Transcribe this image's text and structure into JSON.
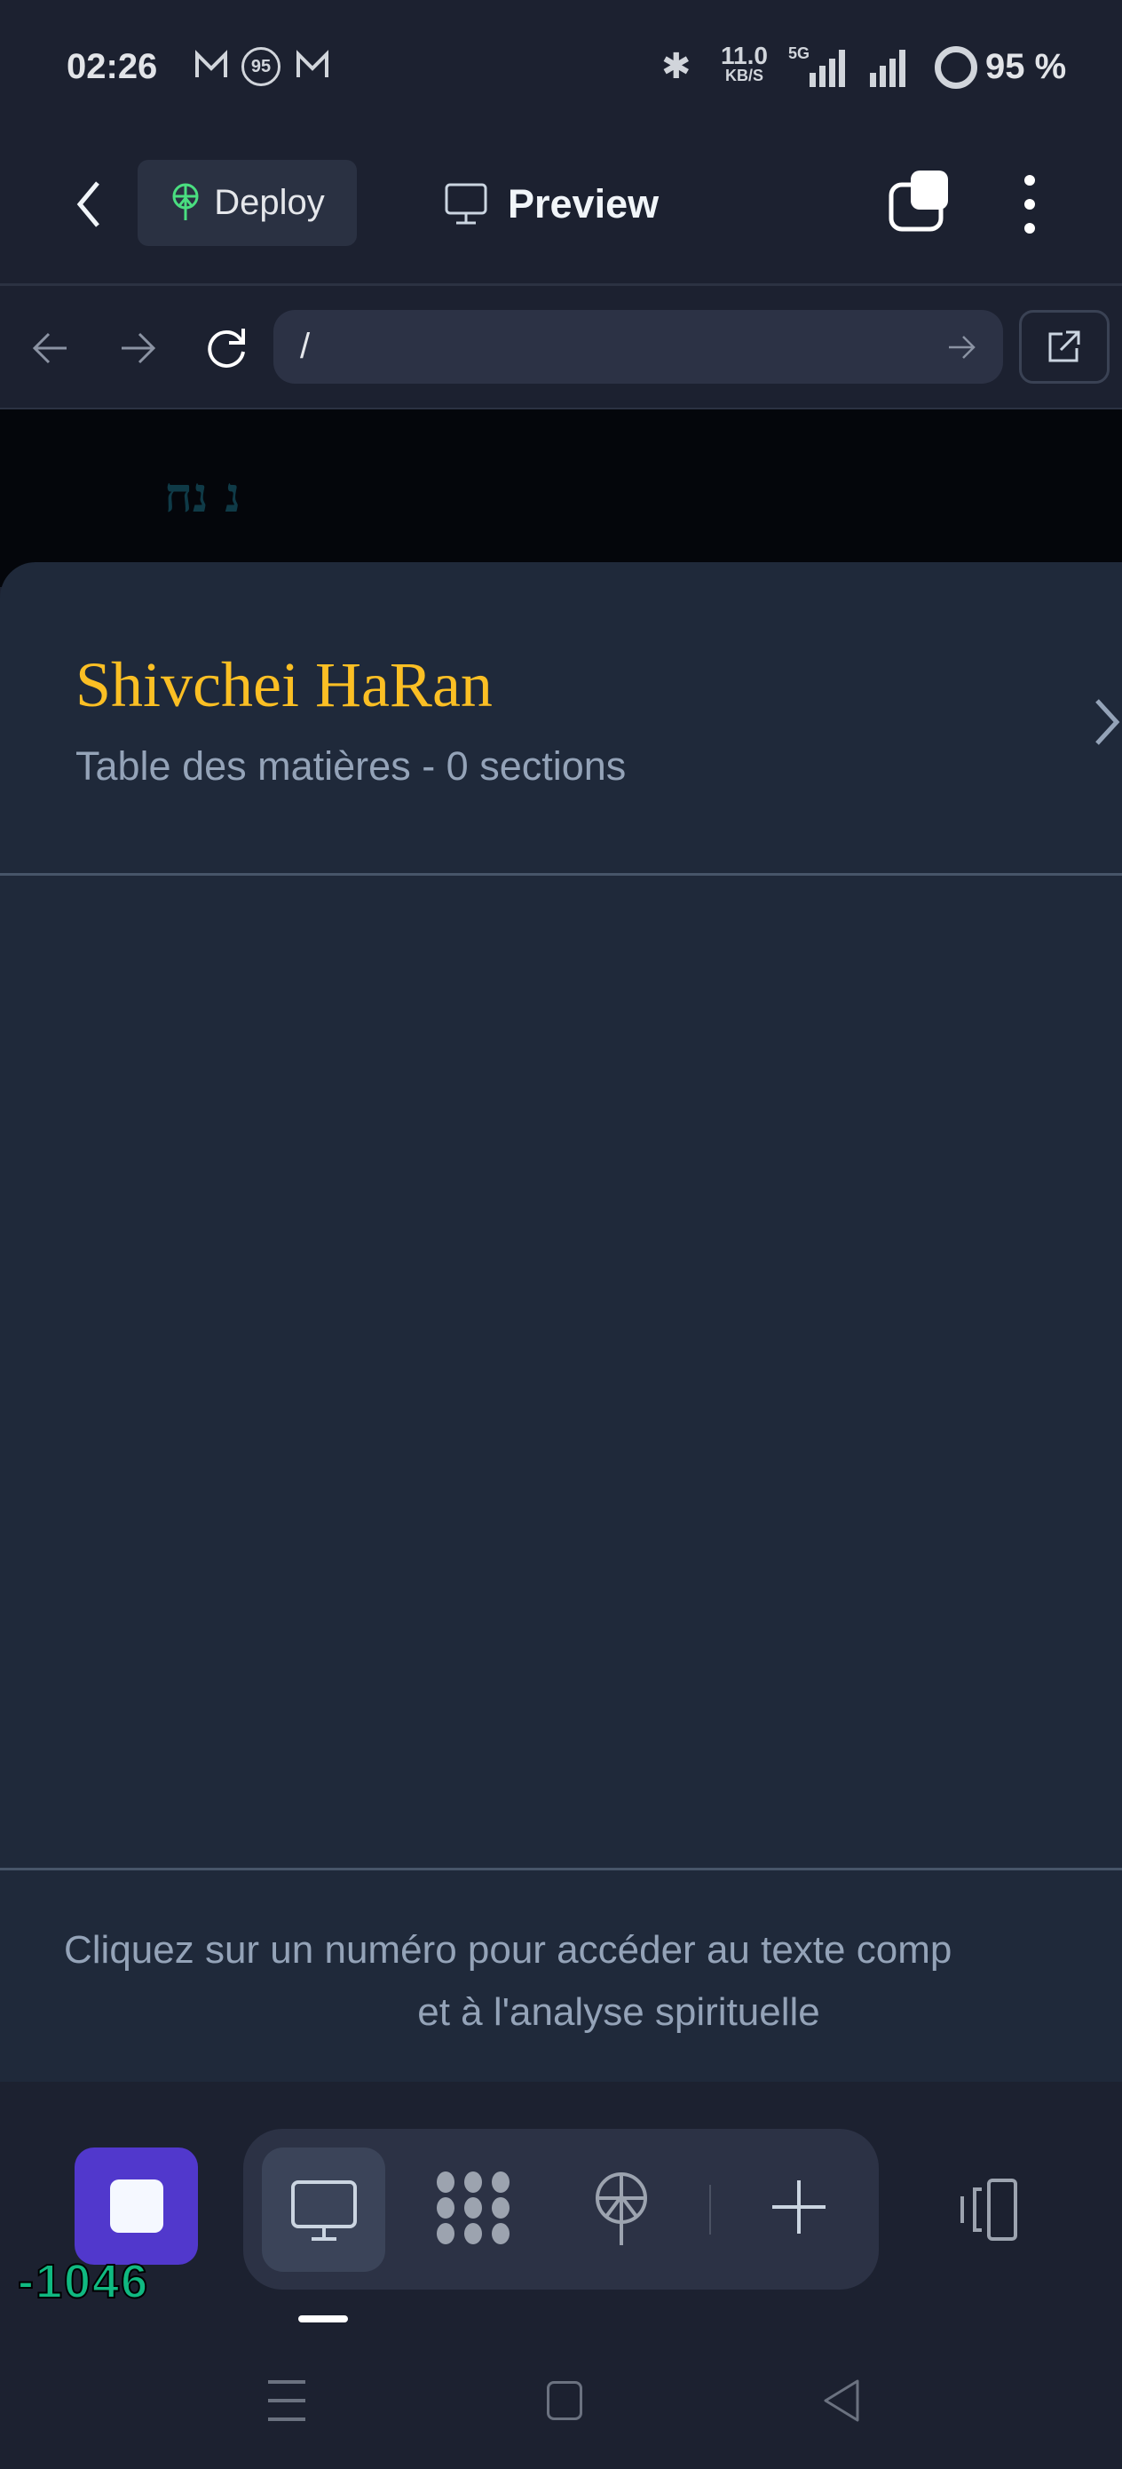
{
  "status_bar": {
    "time": "02:26",
    "network_speed": "11.0",
    "network_unit": "KB/S",
    "network_type": "5G",
    "battery": "95 %",
    "notification_badge": "95"
  },
  "top_bar": {
    "deploy_label": "Deploy",
    "preview_label": "Preview"
  },
  "browser": {
    "url": "/"
  },
  "page": {
    "hebrew_text": "נ נח",
    "title": "Shivchei HaRan",
    "subtitle": "Table des matières - 0 sections",
    "footer_line1": "Cliquez sur un numéro pour accéder au texte comp",
    "footer_line2": "et à l'analyse spirituelle"
  },
  "toolbar": {
    "counter": "-1046"
  },
  "colors": {
    "accent": "#fbbf24",
    "stop_button": "#5138cc",
    "deploy_icon": "#4ade80",
    "counter": "#10b981"
  }
}
